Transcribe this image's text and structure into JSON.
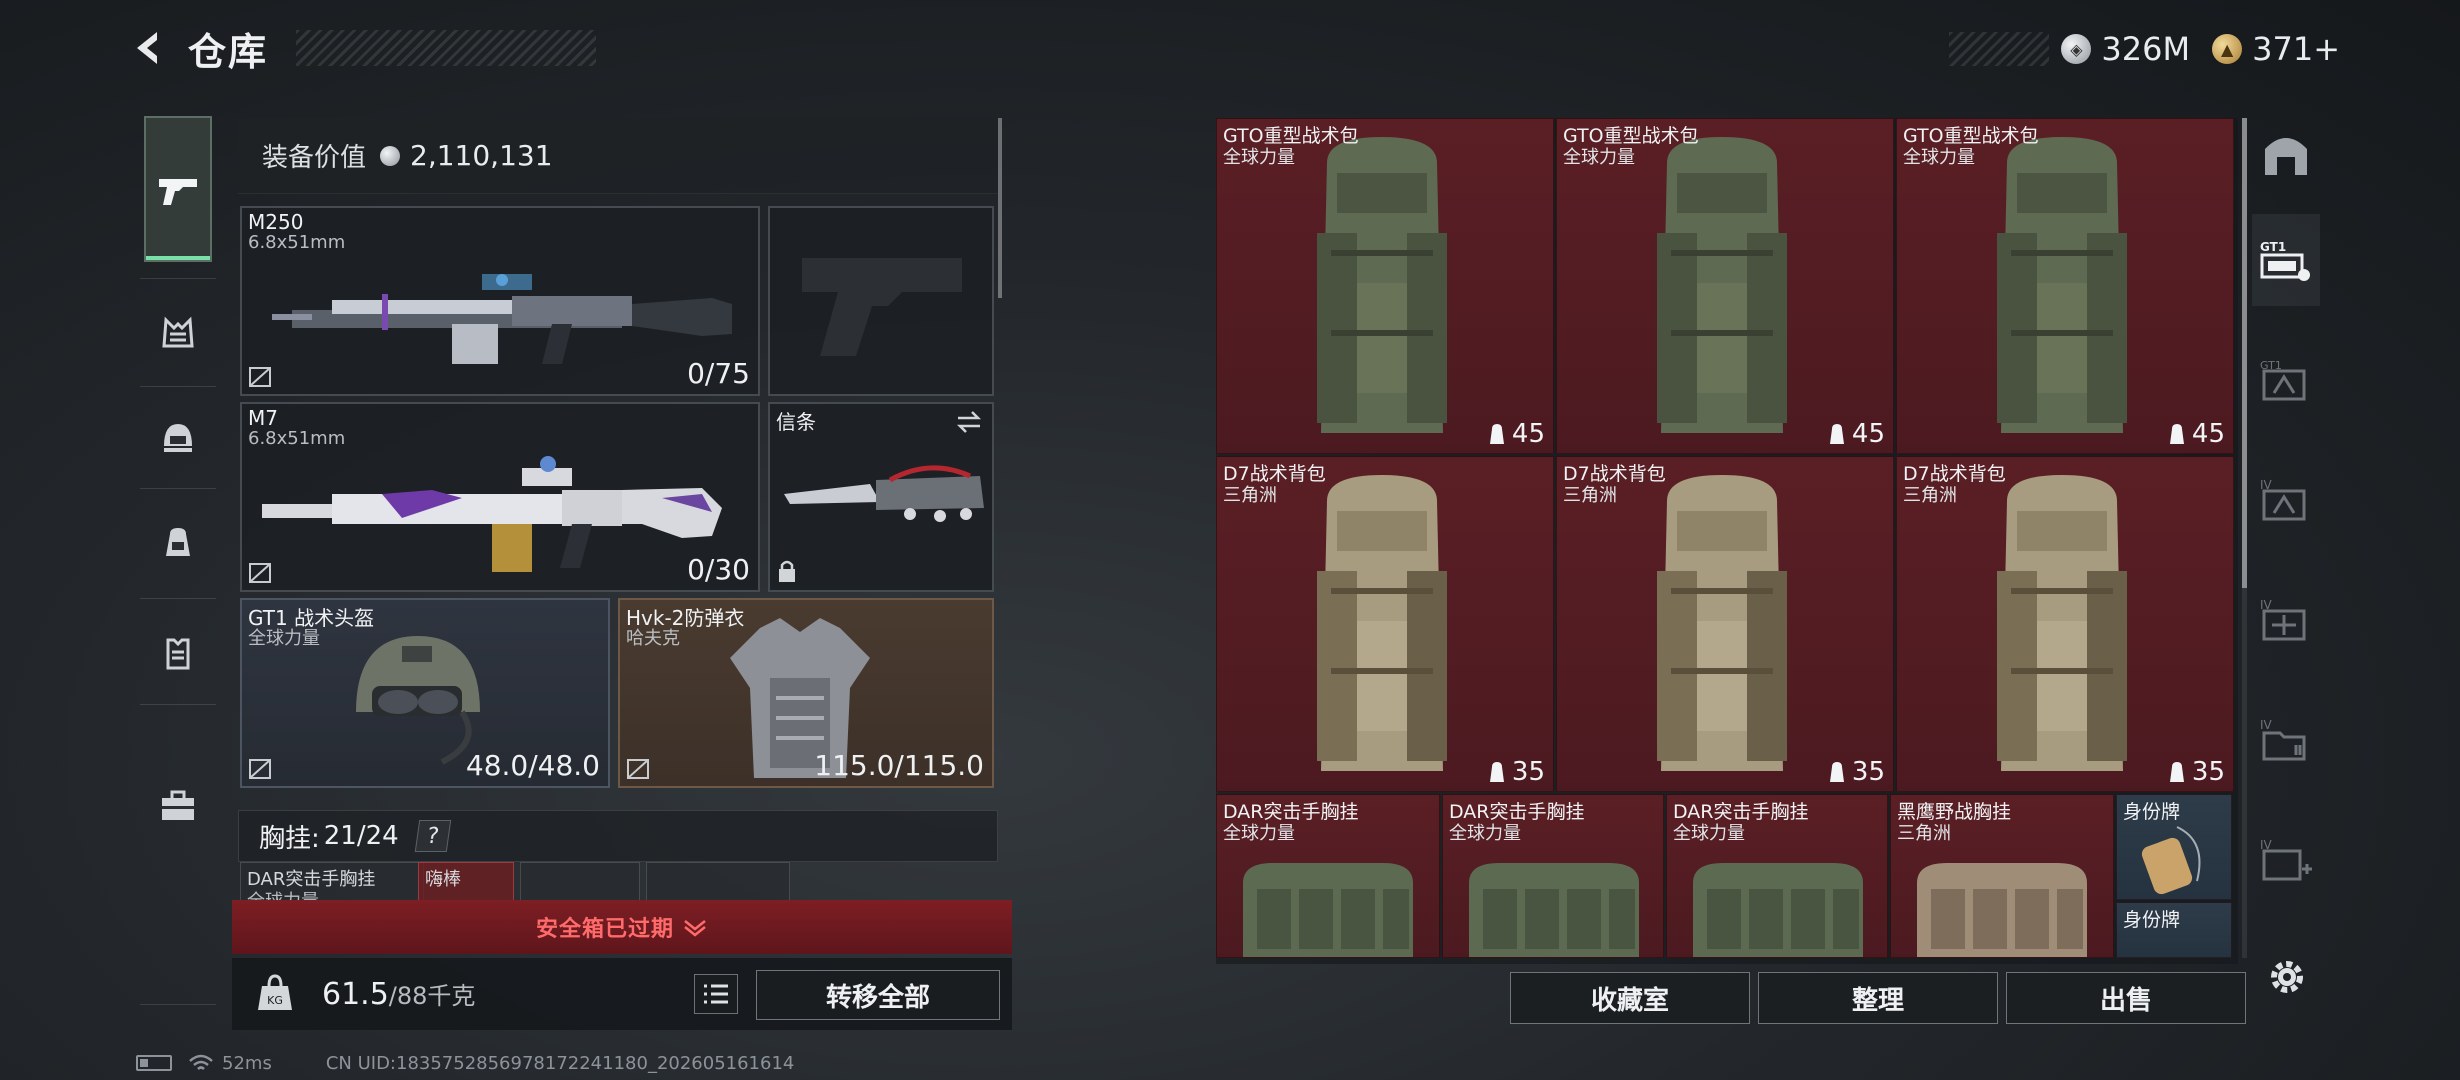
{
  "header": {
    "title": "仓库",
    "currencies": [
      {
        "icon": "silver-coin-icon",
        "value": "326M"
      },
      {
        "icon": "gold-coin-icon",
        "value": "371+"
      }
    ]
  },
  "left_nav": {
    "items": [
      {
        "icon": "pistol-icon",
        "active": true
      },
      {
        "icon": "chest-rig-icon"
      },
      {
        "icon": "helmet-icon"
      },
      {
        "icon": "backpack-icon"
      },
      {
        "icon": "armor-vest-icon"
      },
      {
        "icon": "toolbox-icon"
      }
    ]
  },
  "loadout": {
    "value_label": "装备价值",
    "value": "2,110,131",
    "primary_weapon": {
      "name": "M250",
      "caliber": "6.8x51mm",
      "ammo": "0/75"
    },
    "secondary_weapon": {
      "name": "M7",
      "caliber": "6.8x51mm",
      "ammo": "0/30"
    },
    "melee": {
      "name": "信条"
    },
    "helmet": {
      "name": "GT1 战术头盔",
      "brand": "全球力量",
      "durability": "48.0/48.0"
    },
    "armor": {
      "name": "Hvk-2防弹衣",
      "brand": "哈夫克",
      "durability": "115.0/115.0"
    },
    "chest_rig": {
      "label": "胸挂:",
      "count": "21/24",
      "help": "?"
    },
    "chest_items": [
      {
        "name": "DAR突击手胸挂",
        "sub": "全球力量"
      },
      {
        "name": "嗨棒"
      }
    ],
    "safe_box_banner": "安全箱已过期",
    "weight_current": "61.5",
    "weight_max": "/88千克",
    "transfer_all": "转移全部"
  },
  "status_bar": {
    "ping": "52ms",
    "uid": "CN UID:1835752856978172241180_202605161614"
  },
  "storage": {
    "items": [
      {
        "name": "GTO重型战术包",
        "brand": "全球力量",
        "capacity": "45"
      },
      {
        "name": "GTO重型战术包",
        "brand": "全球力量",
        "capacity": "45"
      },
      {
        "name": "GTO重型战术包",
        "brand": "全球力量",
        "capacity": "45"
      },
      {
        "name": "D7战术背包",
        "brand": "三角洲",
        "capacity": "35"
      },
      {
        "name": "D7战术背包",
        "brand": "三角洲",
        "capacity": "35"
      },
      {
        "name": "D7战术背包",
        "brand": "三角洲",
        "capacity": "35"
      }
    ],
    "rigs": [
      {
        "name": "DAR突击手胸挂",
        "brand": "全球力量"
      },
      {
        "name": "DAR突击手胸挂",
        "brand": "全球力量"
      },
      {
        "name": "DAR突击手胸挂",
        "brand": "全球力量"
      },
      {
        "name": "黑鹰野战胸挂",
        "brand": "三角洲"
      }
    ],
    "tags": [
      {
        "name": "身份牌"
      },
      {
        "name": "身份牌"
      }
    ],
    "buttons": {
      "collection": "收藏室",
      "organize": "整理",
      "sell": "出售"
    }
  },
  "right_nav": {
    "items": [
      {
        "icon": "warehouse-icon"
      },
      {
        "icon": "gt1-tab-icon",
        "active": true
      },
      {
        "icon": "gt1-tab-alt-icon"
      },
      {
        "icon": "tier-iv-tab-icon"
      },
      {
        "icon": "tier-iv-tab-alt-icon"
      },
      {
        "icon": "tier-iv-folder-icon"
      },
      {
        "icon": "tier-iv-add-icon"
      }
    ]
  }
}
